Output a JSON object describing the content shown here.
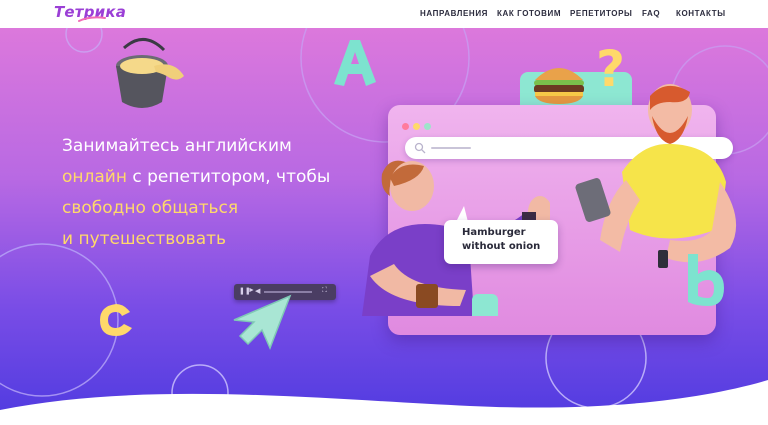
{
  "brand": {
    "logo_text": "Тетрика",
    "accent": "#9b3fd6"
  },
  "nav": {
    "items": [
      {
        "label": "НАПРАВЛЕНИЯ"
      },
      {
        "label": "КАК ГОТОВИМ"
      },
      {
        "label": "РЕПЕТИТОРЫ"
      },
      {
        "label": "FAQ"
      },
      {
        "label": "КОНТАКТЫ"
      }
    ]
  },
  "hero": {
    "headline": {
      "line1": "Занимайтесь английским",
      "line2_highlight": "онлайн",
      "line2_rest": " с репетитором, чтобы",
      "line3": "свободно общаться",
      "line4": "и путешествовать"
    },
    "bubble": {
      "line1": "Hamburger",
      "line2": "without onion"
    },
    "letters": {
      "a": "A",
      "b": "b",
      "c": "c"
    },
    "question_mark": "?",
    "colors": {
      "highlight": "#ffd96a",
      "gradient_top": "#dc78dc",
      "gradient_bottom": "#4e3ae0"
    }
  },
  "icons": [
    "paint-bucket-icon",
    "hamburger-icon",
    "question-mark-icon",
    "search-icon",
    "cursor-arrow-icon",
    "fullscreen-icon",
    "play-icon"
  ]
}
